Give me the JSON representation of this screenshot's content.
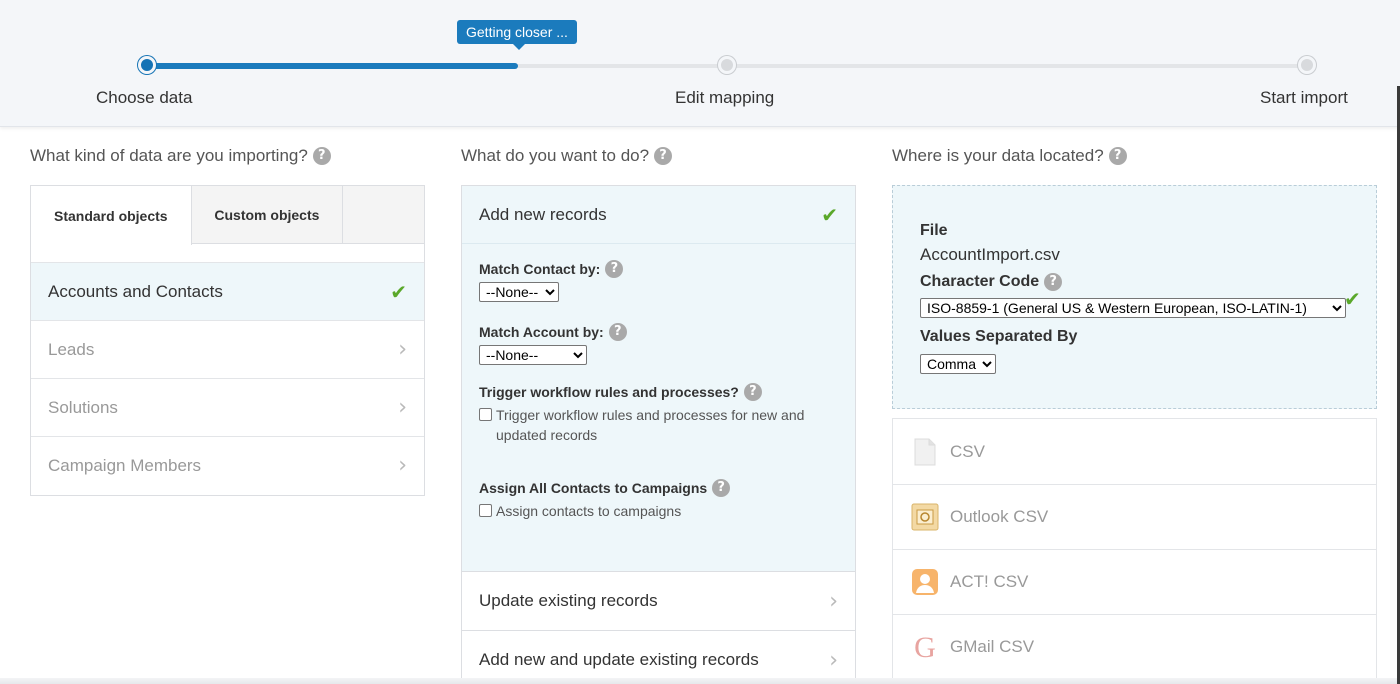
{
  "progress": {
    "tooltip": "Getting closer ...",
    "fill_fraction": 0.32,
    "steps": [
      {
        "label": "Choose data",
        "active": true
      },
      {
        "label": "Edit mapping",
        "active": false
      },
      {
        "label": "Start import",
        "active": false
      }
    ]
  },
  "columns": {
    "objects_heading": "What kind of data are you importing?",
    "actions_heading": "What do you want to do?",
    "location_heading": "Where is your data located?"
  },
  "objects": {
    "tabs": [
      "Standard objects",
      "Custom objects"
    ],
    "items": [
      {
        "label": "Accounts and Contacts",
        "selected": true
      },
      {
        "label": "Leads",
        "selected": false
      },
      {
        "label": "Solutions",
        "selected": false
      },
      {
        "label": "Campaign Members",
        "selected": false
      }
    ]
  },
  "actions": {
    "selected": "Add new records",
    "match_contact_label": "Match Contact by:",
    "match_contact_value": "--None--",
    "match_account_label": "Match Account by:",
    "match_account_value": "--None--",
    "workflow_label": "Trigger workflow rules and processes?",
    "workflow_checkbox": "Trigger workflow rules and processes for new and updated records",
    "campaign_label": "Assign All Contacts to Campaigns",
    "campaign_checkbox": "Assign contacts to campaigns",
    "others": [
      "Update existing records",
      "Add new and update existing records"
    ]
  },
  "file": {
    "file_label": "File",
    "file_name": "AccountImport.csv",
    "charcode_label": "Character Code",
    "charcode_value": "ISO-8859-1 (General US & Western European, ISO-LATIN-1)",
    "separator_label": "Values Separated By",
    "separator_value": "Comma"
  },
  "sources": [
    {
      "label": "CSV",
      "icon": "csv-file-icon"
    },
    {
      "label": "Outlook CSV",
      "icon": "outlook-icon"
    },
    {
      "label": "ACT! CSV",
      "icon": "act-contact-icon"
    },
    {
      "label": "GMail CSV",
      "icon": "gmail-icon"
    }
  ],
  "colors": {
    "accent": "#1b7bbd",
    "selected_bg": "#eef7fa",
    "check": "#5aa82a"
  }
}
